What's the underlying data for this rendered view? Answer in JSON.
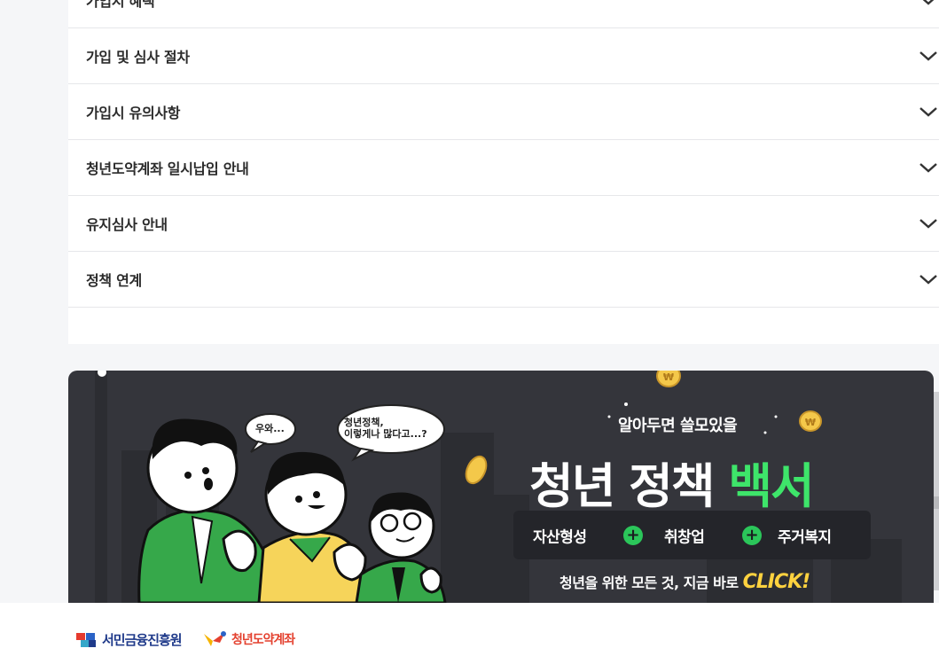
{
  "accordion": {
    "items": [
      {
        "label": "가입시 혜택"
      },
      {
        "label": "가입 및 심사 절차"
      },
      {
        "label": "가입시 유의사항"
      },
      {
        "label": "청년도약계좌 일시납입 안내"
      },
      {
        "label": "유지심사 안내"
      },
      {
        "label": "정책 연계"
      }
    ],
    "chevron_icon": "chevron-down-icon"
  },
  "banner": {
    "bubble_1": "우와...",
    "bubble_2": "청년정책,\n이렇게나 많다고...?",
    "kicker": "알아두면 쓸모있을",
    "headline_white": "청년 정책 ",
    "headline_green": "백서",
    "tags": [
      "자산형성",
      "취창업",
      "주거복지"
    ],
    "cta_text": "청년을 위한 모든 것, 지금 바로 ",
    "cta_click": "CLICK!",
    "colors": {
      "background": "#34353b",
      "accent_green": "#3ee56a",
      "accent_yellow": "#ffd23f"
    }
  },
  "footer": {
    "logo_1": "서민금융진흥원",
    "logo_2": "청년도약계좌"
  }
}
